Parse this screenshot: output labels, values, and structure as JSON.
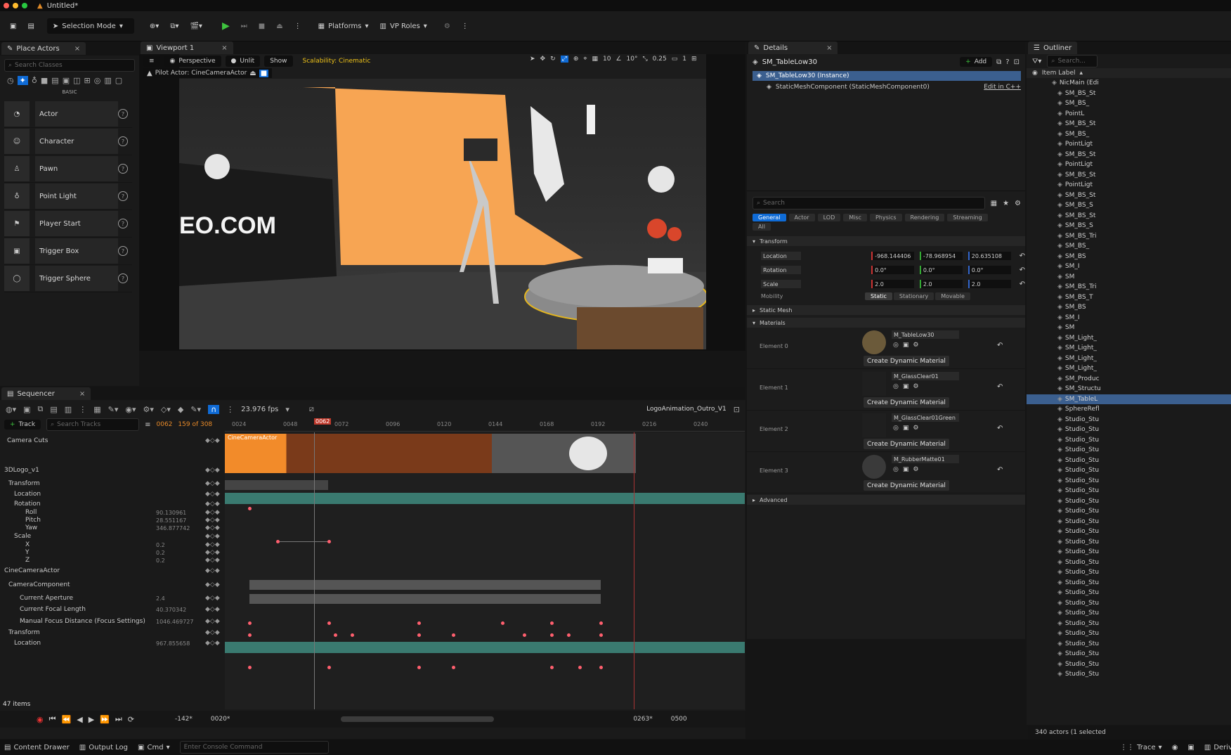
{
  "window": {
    "title": "Untitled*"
  },
  "toolbar": {
    "mode": "Selection Mode",
    "platforms": "Platforms",
    "vp_roles": "VP Roles"
  },
  "place_actors": {
    "tab": "Place Actors",
    "search_placeholder": "Search Classes",
    "section": "BASIC",
    "items": [
      {
        "label": "Actor"
      },
      {
        "label": "Character"
      },
      {
        "label": "Pawn"
      },
      {
        "label": "Point Light"
      },
      {
        "label": "Player Start"
      },
      {
        "label": "Trigger Box"
      },
      {
        "label": "Trigger Sphere"
      }
    ]
  },
  "viewport": {
    "tab": "Viewport 1",
    "perspective": "Perspective",
    "unlit": "Unlit",
    "show": "Show",
    "scalability": "Scalability: Cinematic",
    "pilot": "Pilot Actor: CineCameraActor",
    "grid": "10",
    "angle": "10°",
    "scale": "0.25",
    "cam": "1",
    "banner_text": "EO.COM"
  },
  "details": {
    "tab": "Details",
    "object": "SM_TableLow30",
    "add": "Add",
    "instance": "SM_TableLow30 (Instance)",
    "component": "StaticMeshComponent (StaticMeshComponent0)",
    "edit_cpp": "Edit in C++",
    "search_placeholder": "Search",
    "categories": [
      "General",
      "Actor",
      "LOD",
      "Misc",
      "Physics",
      "Rendering",
      "Streaming"
    ],
    "all": "All",
    "transform_header": "Transform",
    "location_label": "Location",
    "location": [
      "-968.144406",
      "-78.968954",
      "20.635108"
    ],
    "rotation_label": "Rotation",
    "rotation": [
      "0.0°",
      "0.0°",
      "0.0°"
    ],
    "scale_label": "Scale",
    "scale": [
      "2.0",
      "2.0",
      "2.0"
    ],
    "mobility_label": "Mobility",
    "mobility": [
      "Static",
      "Stationary",
      "Movable"
    ],
    "static_mesh": "Static Mesh",
    "materials_header": "Materials",
    "elements": [
      {
        "label": "Element 0",
        "material": "M_TableLow30"
      },
      {
        "label": "Element 1",
        "material": "M_GlassClear01"
      },
      {
        "label": "Element 2",
        "material": "M_GlassClear01Green"
      },
      {
        "label": "Element 3",
        "material": "M_RubberMatte01"
      }
    ],
    "dyn_button": "Create Dynamic Material",
    "advanced": "Advanced"
  },
  "outliner": {
    "tab": "Outliner",
    "search_placeholder": "Search...",
    "column": "Item Label",
    "items": [
      "NicMain (Edi",
      "SM_BS_St",
      "SM_BS_",
      "PointL",
      "SM_BS_St",
      "SM_BS_",
      "PointLigt",
      "SM_BS_St",
      "PointLigt",
      "SM_BS_St",
      "PointLigt",
      "SM_BS_St",
      "SM_BS_S",
      "SM_BS_St",
      "SM_BS_S",
      "SM_BS_Tri",
      "SM_BS_",
      "SM_BS",
      "SM_I",
      "SM",
      "SM_BS_Tri",
      "SM_BS_T",
      "SM_BS",
      "SM_I",
      "SM",
      "SM_Light_",
      "SM_Light_",
      "SM_Light_",
      "SM_Light_",
      "SM_Produc",
      "SM_Structu",
      "SM_TableL",
      "SphereRefl",
      "Studio_Stu",
      "Studio_Stu",
      "Studio_Stu",
      "Studio_Stu",
      "Studio_Stu",
      "Studio_Stu",
      "Studio_Stu",
      "Studio_Stu",
      "Studio_Stu",
      "Studio_Stu",
      "Studio_Stu",
      "Studio_Stu",
      "Studio_Stu",
      "Studio_Stu",
      "Studio_Stu",
      "Studio_Stu",
      "Studio_Stu",
      "Studio_Stu",
      "Studio_Stu",
      "Studio_Stu",
      "Studio_Stu",
      "Studio_Stu",
      "Studio_Stu",
      "Studio_Stu",
      "Studio_Stu",
      "Studio_Stu"
    ],
    "selected_index": 31,
    "footer": "340 actors (1 selected"
  },
  "sequencer": {
    "tab": "Sequencer",
    "fps": "23.976 fps",
    "sequence_name": "LogoAnimation_Outro_V1",
    "track_button": "Track",
    "search_placeholder": "Search Tracks",
    "current_frame": "0062",
    "frame_count": "159 of 308",
    "playhead": "0062",
    "ruler": [
      "0024",
      "0048",
      "0072",
      "0096",
      "0120",
      "0144",
      "0168",
      "0192",
      "0216",
      "0240"
    ],
    "camera_cut_label": "CineCameraActor",
    "tracks": [
      {
        "name": "Camera Cuts",
        "value": ""
      },
      {
        "name": "3DLogo_v1",
        "value": ""
      },
      {
        "name": "Transform",
        "value": ""
      },
      {
        "name": "Location",
        "value": ""
      },
      {
        "name": "Rotation",
        "value": ""
      },
      {
        "name": "Roll",
        "value": "90.130961"
      },
      {
        "name": "Pitch",
        "value": "28.551167"
      },
      {
        "name": "Yaw",
        "value": "346.877742"
      },
      {
        "name": "Scale",
        "value": ""
      },
      {
        "name": "X",
        "value": "0.2"
      },
      {
        "name": "Y",
        "value": "0.2"
      },
      {
        "name": "Z",
        "value": "0.2"
      },
      {
        "name": "CineCameraActor",
        "value": ""
      },
      {
        "name": "CameraComponent",
        "value": ""
      },
      {
        "name": "Current Aperture",
        "value": "2.4"
      },
      {
        "name": "Current Focal Length",
        "value": "40.370342"
      },
      {
        "name": "Manual Focus Distance (Focus Settings)",
        "value": "1046.469727"
      },
      {
        "name": "Transform",
        "value": ""
      },
      {
        "name": "Location",
        "value": "967.855658"
      }
    ],
    "items_count": "47 items",
    "range_start": "-142*",
    "range_in": "0020*",
    "range_out": "0263*",
    "range_end": "0500"
  },
  "statusbar": {
    "content_drawer": "Content Drawer",
    "output_log": "Output Log",
    "cmd": "Cmd",
    "console_placeholder": "Enter Console Command",
    "trace": "Trace",
    "derived": "Deriv"
  },
  "colors": {
    "accent": "#0f6bd6",
    "backdrop": "#f7a553",
    "key": "#ff5f6e",
    "track": "#3a7a70"
  }
}
